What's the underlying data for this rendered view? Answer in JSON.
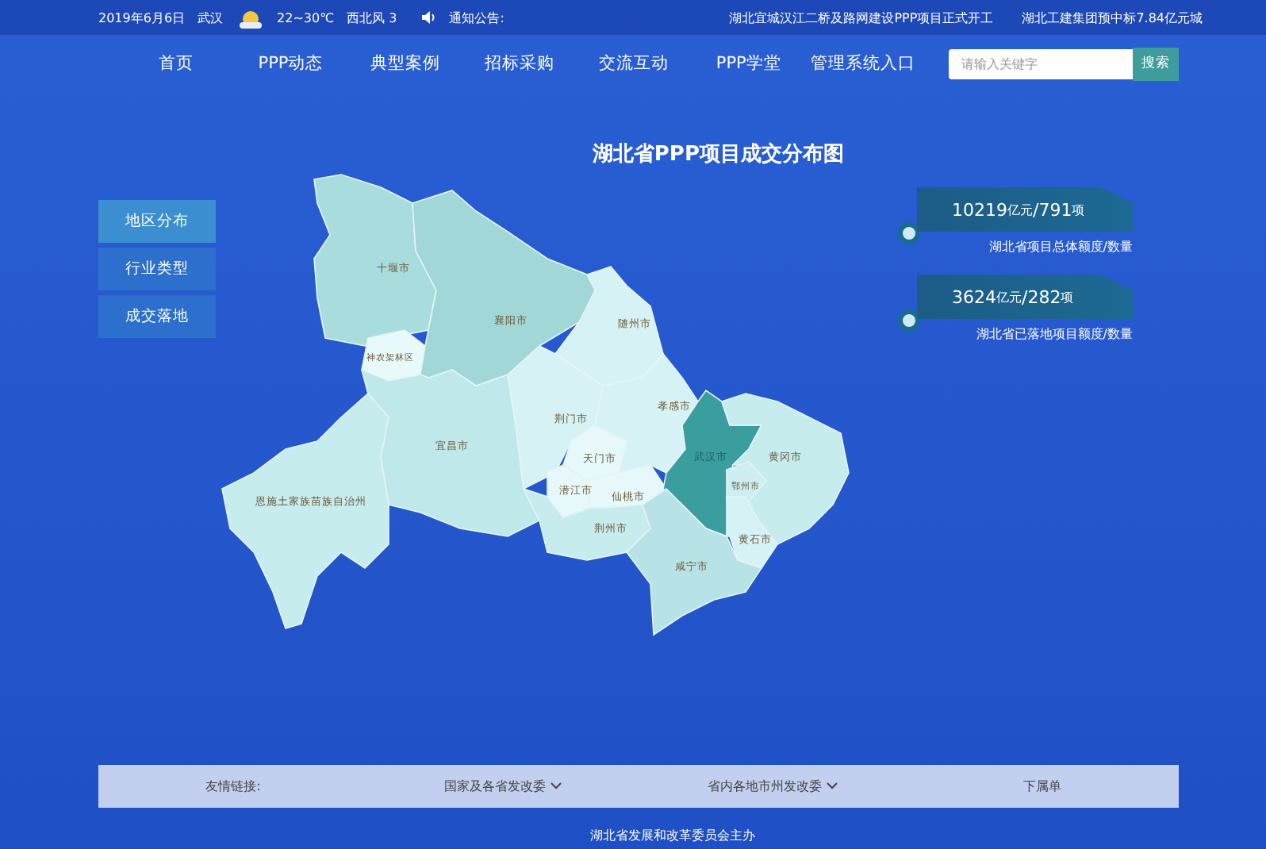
{
  "top_bar": {
    "date": "2019年6月6日",
    "city": "武汉",
    "temperature": "22~30℃",
    "wind": "西北风 3",
    "notice_label": "通知公告:",
    "notices": [
      "湖北宜城汉江二桥及路网建设PPP项目正式开工",
      "湖北工建集团预中标7.84亿元城"
    ]
  },
  "nav": {
    "items": [
      "首页",
      "PPP动态",
      "典型案例",
      "招标采购",
      "交流互动",
      "PPP学堂",
      "管理系统入口"
    ]
  },
  "search": {
    "placeholder": "请输入关键字",
    "button": "搜索"
  },
  "sidebar": {
    "tabs": [
      {
        "label": "地区分布",
        "selected": true
      },
      {
        "label": "行业类型",
        "selected": false
      },
      {
        "label": "成交落地",
        "selected": false
      }
    ]
  },
  "map": {
    "title": "湖北省PPP项目成交分布图",
    "regions": [
      {
        "name": "十堰市",
        "color": "#a9dcdc"
      },
      {
        "name": "襄阳市",
        "color": "#a2d7d8"
      },
      {
        "name": "神农架林区",
        "color": "#e8f9fa"
      },
      {
        "name": "随州市",
        "color": "#d7f2f4"
      },
      {
        "name": "宜昌市",
        "color": "#bfe8ea"
      },
      {
        "name": "恩施土家族苗族自治州",
        "color": "#c6ecee"
      },
      {
        "name": "荆门市",
        "color": "#d7f2f4"
      },
      {
        "name": "孝感市",
        "color": "#d7f2f4"
      },
      {
        "name": "天门市",
        "color": "#e6f8f9"
      },
      {
        "name": "潜江市",
        "color": "#e6f8f9"
      },
      {
        "name": "仙桃市",
        "color": "#e6f8f9"
      },
      {
        "name": "荆州市",
        "color": "#c6ecee"
      },
      {
        "name": "武汉市",
        "color": "#3a9e9e"
      },
      {
        "name": "黄冈市",
        "color": "#c6ecee"
      },
      {
        "name": "鄂州市",
        "color": "#cdeff1"
      },
      {
        "name": "黄石市",
        "color": "#d7f2f4"
      },
      {
        "name": "咸宁市",
        "color": "#b8e3e6"
      }
    ]
  },
  "stats": [
    {
      "amount": "10219",
      "amount_unit": "亿元",
      "separator": "/",
      "count": "791",
      "count_unit": "项",
      "caption": "湖北省项目总体额度/数量"
    },
    {
      "amount": "3624",
      "amount_unit": "亿元",
      "separator": "/",
      "count": "282",
      "count_unit": "项",
      "caption": "湖北省已落地项目额度/数量"
    }
  ],
  "footer": {
    "links_label": "友情链接:",
    "links": [
      "国家及各省发改委",
      "省内各地市州发改委",
      "下属单"
    ],
    "sponsor": "湖北省发展和改革委员会主办"
  }
}
